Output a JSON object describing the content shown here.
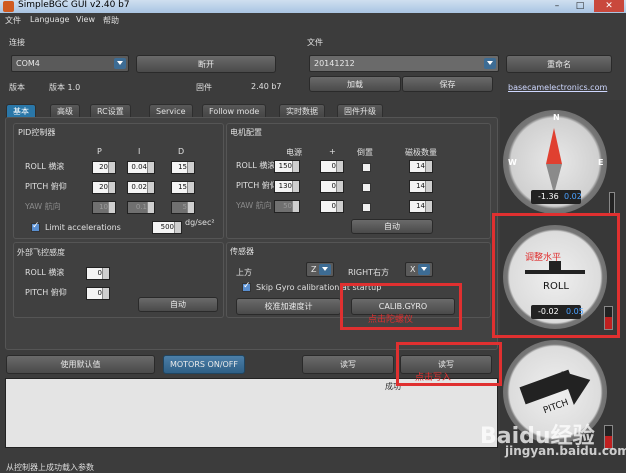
{
  "window": {
    "title": "SimpleBGC GUI v2.40 b7",
    "minimize": "–",
    "maximize": "□",
    "close": "✕"
  },
  "menu": [
    "文件",
    "Language",
    "View",
    "帮助"
  ],
  "connection": {
    "title": "连接",
    "port": "COM4",
    "disconnect": "断开",
    "version_label": "版本",
    "version_value": "版本 1.0",
    "firmware_label": "固件",
    "firmware_value": "2.40 b7"
  },
  "file": {
    "title": "文件",
    "profile": "20141212",
    "rename": "重命名",
    "load": "加载",
    "save": "保存",
    "site": "basecamelectronics.com"
  },
  "tabs": [
    "基本",
    "高级",
    "RC设置",
    "Service",
    "Follow mode",
    "实时数据",
    "固件升级"
  ],
  "pid": {
    "title": "PID控制器",
    "col_p": "P",
    "col_i": "I",
    "col_d": "D",
    "rows": [
      {
        "label": "ROLL 横滚",
        "p": "20",
        "i": "0.04",
        "d": "15"
      },
      {
        "label": "PITCH 俯仰",
        "p": "20",
        "i": "0.02",
        "d": "15"
      },
      {
        "label": "YAW 航向",
        "p": "10",
        "i": "0.1",
        "d": "5"
      }
    ],
    "limit_label": "Limit accelerations",
    "limit_value": "500",
    "limit_unit": "dg/sec²"
  },
  "motor": {
    "title": "电机配置",
    "col_power": "电源",
    "col_plus": "+",
    "col_invert": "倒置",
    "col_poles": "磁极数量",
    "rows": [
      {
        "label": "ROLL 横滚",
        "power": "150",
        "plus": "0",
        "poles": "14"
      },
      {
        "label": "PITCH 俯仰",
        "power": "130",
        "plus": "0",
        "poles": "14"
      },
      {
        "label": "YAW 航向",
        "power": "50",
        "plus": "0",
        "poles": "14"
      }
    ],
    "auto": "自动"
  },
  "ext_gain": {
    "title": "外部飞控感度",
    "roll_label": "ROLL 横滚",
    "roll": "0",
    "pitch_label": "PITCH 俯仰",
    "pitch": "0",
    "auto": "自动"
  },
  "sensor": {
    "title": "传感器",
    "top_label": "上方",
    "top_value": "Z",
    "right_label": "RIGHT右方",
    "right_value": "X",
    "skip_gyro": "Skip Gyro calibration at startup",
    "calib_acc": "校准加速度计",
    "calib_gyro": "CALIB.GYRO"
  },
  "bottom": {
    "defaults": "使用默认值",
    "motors": "MOTORS ON/OFF",
    "read": "读写",
    "write": "读写"
  },
  "log": {
    "text": "成功",
    "status": "从控制器上成功载入参数"
  },
  "gauges": {
    "yaw": {
      "n": "N",
      "w": "W",
      "e": "E",
      "value": "-1.36",
      "sub": "0.02"
    },
    "roll": {
      "name": "ROLL",
      "value": "-0.02",
      "sub": "0.05"
    },
    "pitch": {
      "name": "PITCH"
    }
  },
  "annotations": {
    "level": "调整水平",
    "click_gyro": "点击陀螺仪",
    "click_write": "点击写入"
  },
  "watermark": {
    "brand": "Baidu经验",
    "url": "jingyan.baidu.com"
  },
  "colors": {
    "accent": "#2a77a8",
    "highlight": "#e03030",
    "background": "#3c3c3c"
  }
}
